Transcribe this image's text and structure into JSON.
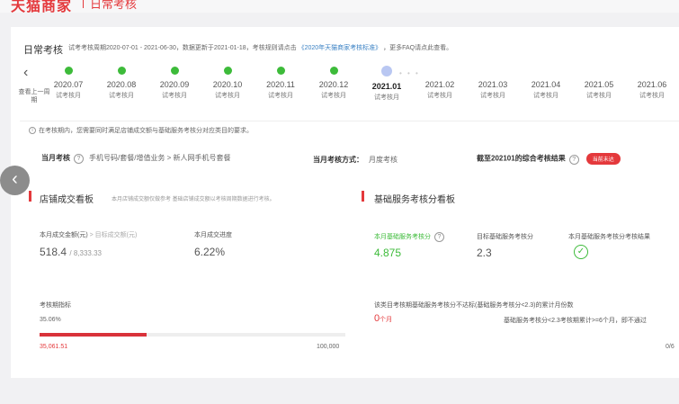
{
  "header": {
    "brand": "天猫商家",
    "title": "日常考核"
  },
  "page": {
    "title": "日常考核",
    "period_info": "试考考核周期2020-07-01 - 2021-06-30，数据更新于2021-01-18，考核规则请点击",
    "rule_link": "《2020年天猫商家考核标准》",
    "faq_text": "，更多FAQ请点此查看。"
  },
  "timeline": {
    "prev_label": "查看上一周期",
    "months": [
      {
        "month": "2020.07",
        "status": "试考核月",
        "state": "done"
      },
      {
        "month": "2020.08",
        "status": "试考核月",
        "state": "done"
      },
      {
        "month": "2020.09",
        "status": "试考核月",
        "state": "done"
      },
      {
        "month": "2020.10",
        "status": "试考核月",
        "state": "done"
      },
      {
        "month": "2020.11",
        "status": "试考核月",
        "state": "done"
      },
      {
        "month": "2020.12",
        "status": "试考核月",
        "state": "done"
      },
      {
        "month": "2021.01",
        "status": "试考核月",
        "state": "current"
      },
      {
        "month": "2021.02",
        "status": "试考核月",
        "state": "future"
      },
      {
        "month": "2021.03",
        "status": "试考核月",
        "state": "future"
      },
      {
        "month": "2021.04",
        "status": "试考核月",
        "state": "future"
      },
      {
        "month": "2021.05",
        "status": "试考核月",
        "state": "future"
      },
      {
        "month": "2021.06",
        "status": "试考核月",
        "state": "future"
      }
    ]
  },
  "notice": "在考核期内，您需要同时满足店铺成交额与基础服务考核分对应类目的要求。",
  "assessment": {
    "category_label": "当月考核",
    "category_path": "手机号码/套餐/增值业务 > 新人网手机号套餐",
    "method_label": "当月考核方式：",
    "method_value": "月度考核",
    "result_label": "截至202101的综合考核结果",
    "result_badge": "当前未达"
  },
  "store_board": {
    "title": "店铺成交看板",
    "desc": "本月店铺成交额仅做参考    基础店铺成交额以考核周期数据进行考核。",
    "amount_label": "本月成交金额(元)",
    "amount_target_label": "> 目标成交额(元)",
    "amount_value": "518.4",
    "amount_target": "8,333.33",
    "progress_label": "本月成交进度",
    "progress_value": "6.22%",
    "cycle_label": "考核期指标",
    "cycle_percent": "35.06%",
    "cycle_progress": 0.3506,
    "cycle_current": "35,061.51",
    "cycle_total": "100,000"
  },
  "service_board": {
    "title": "基础服务考核分看板",
    "score_label": "本月基础服务考核分",
    "score_value": "4.875",
    "target_label": "目标基础服务考核分",
    "target_value": "2.3",
    "result_label": "本月基础服务考核分考核结果",
    "fail_text": "该类目考核期基础服务考核分不达标(基础服务考核分<2.3)的累计月份数",
    "fail_count": "0",
    "fail_unit": "个月",
    "fail_rule": "基础服务考核分<2.3考核期累计>=6个月，即不通过",
    "fail_max": "0/6"
  },
  "colors": {
    "brand_red": "#e4393c",
    "done_green": "#3dbb3a",
    "current_blue": "#b9c7f2"
  }
}
